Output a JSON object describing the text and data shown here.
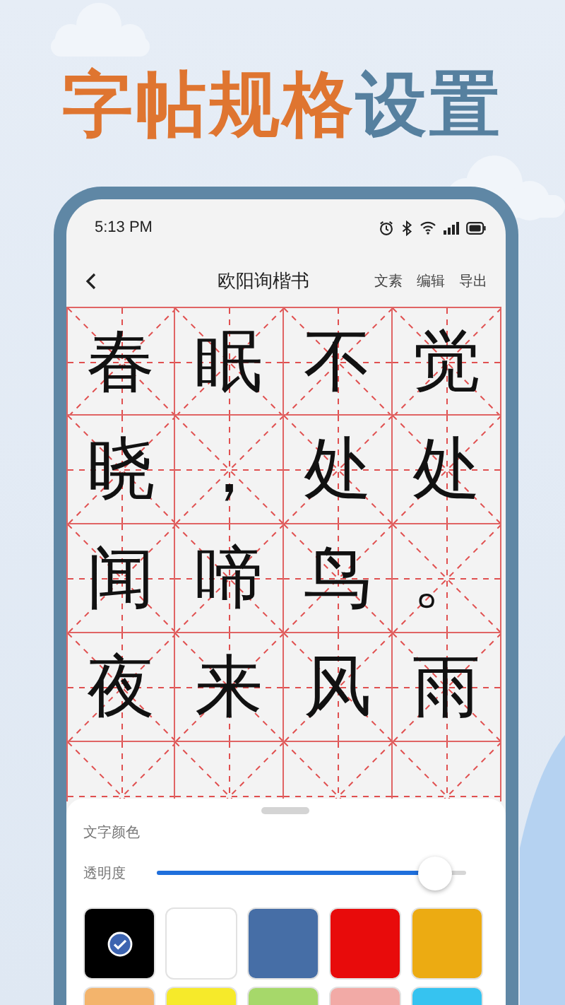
{
  "headline": {
    "lead": "字帖规格",
    "tail": "设置"
  },
  "status_bar": {
    "time": "5:13 PM"
  },
  "nav": {
    "title": "欧阳询楷书",
    "actions": [
      "文素",
      "编辑",
      "导出"
    ]
  },
  "grid": {
    "rows": [
      [
        "春",
        "眠",
        "不",
        "觉"
      ],
      [
        "晓",
        "，",
        "处",
        "处"
      ],
      [
        "闻",
        "啼",
        "鸟",
        "。"
      ],
      [
        "夜",
        "来",
        "风",
        "雨"
      ]
    ]
  },
  "sheet": {
    "section_label": "文字颜色",
    "opacity": {
      "label": "透明度",
      "level": 0.95
    },
    "swatches": [
      {
        "color": "#000000",
        "selected": true
      },
      {
        "color": "#ffffff",
        "selected": false
      },
      {
        "color": "#466ea6",
        "selected": false
      },
      {
        "color": "#e80b0b",
        "selected": false
      },
      {
        "color": "#ecab12",
        "selected": false
      }
    ],
    "more_swatches": [
      {
        "color": "#f3b46c"
      },
      {
        "color": "#f6ea2a"
      },
      {
        "color": "#a6d86a"
      },
      {
        "color": "#f2aaa6"
      },
      {
        "color": "#36c3f0"
      }
    ]
  }
}
